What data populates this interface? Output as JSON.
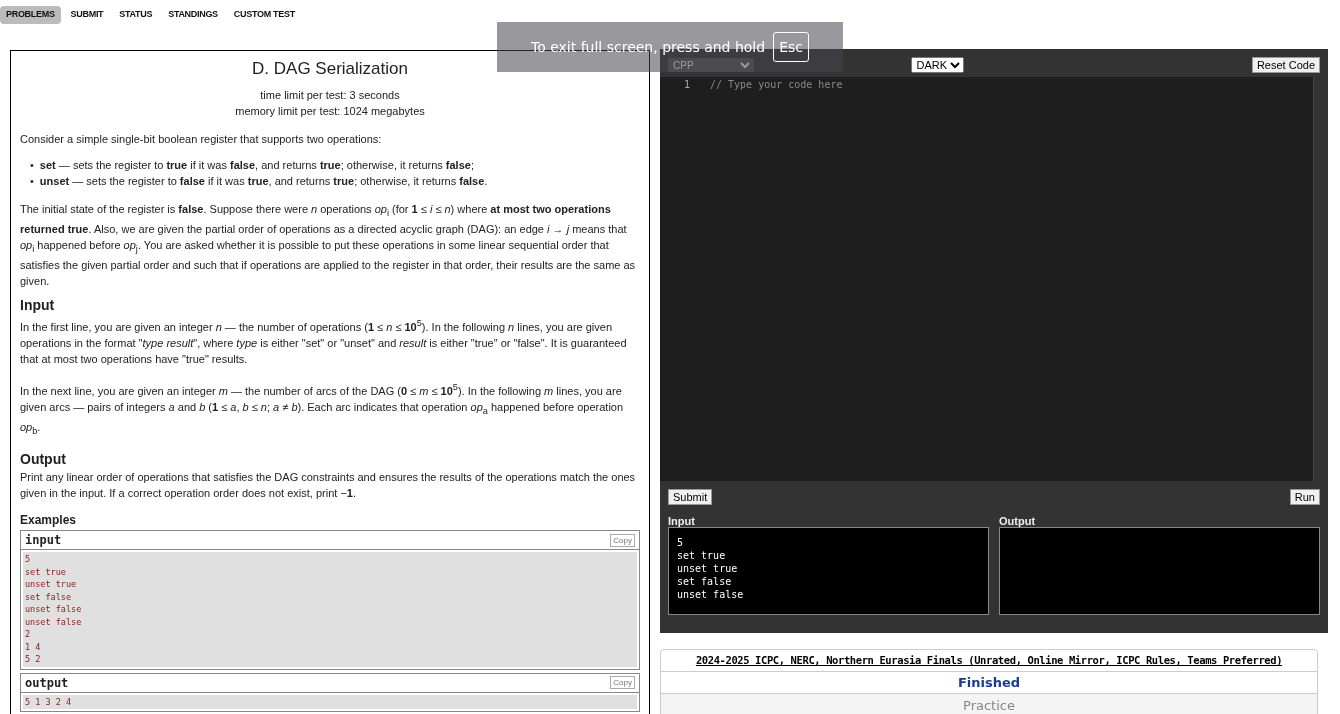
{
  "nav": [
    {
      "label": "PROBLEMS",
      "selected": true
    },
    {
      "label": "SUBMIT",
      "selected": false
    },
    {
      "label": "STATUS",
      "selected": false
    },
    {
      "label": "STANDINGS",
      "selected": false
    },
    {
      "label": "CUSTOM TEST",
      "selected": false
    }
  ],
  "problem": {
    "title": "D. DAG Serialization",
    "time_limit": "time limit per test: 3 seconds",
    "memory_limit": "memory limit per test: 1024 megabytes",
    "legend": [
      "Consider a simple single-bit boolean register that supports two operations:"
    ],
    "bullets": [
      {
        "marker": "•",
        "text": "**set** — sets the register to **true** if it was **false**, and returns **true**; otherwise, it returns **false**;"
      },
      {
        "marker": "•",
        "text": "**unset** — sets the register to **false** if it was **true**, and returns **true**; otherwise, it returns **false**."
      }
    ],
    "legend_after": [
      "The initial state of the register is **false**. Suppose there were *n* operations *op*$_{i}$ (for **1** ≤ *i* ≤ *n*) where **at most two operations returned true**. Also, we are given the partial order of operations as a directed acyclic graph (DAG): an edge *i* → *j* means that *op*$_{i}$ happened before *op*$_{j}$. You are asked whether it is possible to put these operations in some linear sequential order that satisfies the given partial order and such that if operations are applied to the register in that order, their results are the same as given."
    ],
    "input_title": "Input",
    "input_spec": [
      "In the first line, you are given an integer *n* — the number of operations (**1** ≤ *n* ≤ **10**$^{5}$). In the following *n* lines, you are given operations in the format \"*type result*\", where *type* is either \"set\" or \"unset\" and *result* is either \"true\" or \"false\". It is guaranteed that at most two operations have \"true\" results.",
      "In the next line, you are given an integer *m* — the number of arcs of the DAG (**0** ≤ *m* ≤ **10**$^{5}$). In the following *m* lines, you are given arcs — pairs of integers *a* and *b* (**1** ≤ *a*, *b* ≤ *n*; *a* ≠ *b*). Each arc indicates that operation *op*$_{a}$ happened before operation *op*$_{b}$."
    ],
    "output_title": "Output",
    "output_spec": [
      "Print any linear order of operations that satisfies the DAG constraints and ensures the results of the operations match the ones given in the input. If a correct operation order does not exist, print −**1**."
    ],
    "examples_title": "Examples",
    "samples": [
      {
        "title": "input",
        "copy": "Copy",
        "lines": [
          "5",
          "set true",
          "unset true",
          "set false",
          "unset false",
          "unset false",
          "2",
          "1 4",
          "5 2"
        ]
      },
      {
        "title": "output",
        "copy": "Copy",
        "lines": [
          "5 1 3 2 4"
        ]
      }
    ]
  },
  "editor": {
    "language": "CPP",
    "theme": "DARK",
    "reset": "Reset Code",
    "line_number": "1",
    "code": "// Type your code here",
    "submit": "Submit",
    "run": "Run",
    "input_label": "Input",
    "output_label": "Output",
    "input_lines": [
      "5",
      "set true",
      "unset true",
      "set false",
      "unset false"
    ]
  },
  "contest": {
    "name": "2024-2025 ICPC, NERC, Northern Eurasia Finals (Unrated, Online Mirror, ICPC Rules, Teams Preferred)",
    "status": "Finished",
    "phase": "Practice"
  },
  "toast": {
    "text": "To exit full screen, press and hold",
    "key": "Esc"
  }
}
